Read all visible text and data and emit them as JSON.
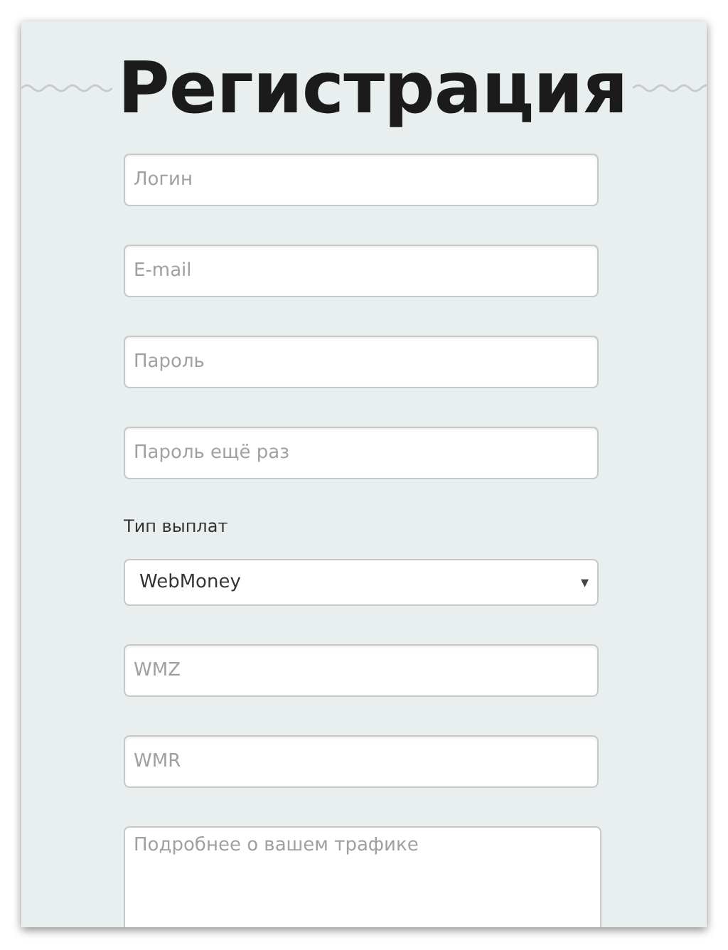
{
  "title": "Регистрация",
  "fields": [
    {
      "kind": "input",
      "placeholder": "Логин"
    },
    {
      "kind": "input",
      "placeholder": "E-mail"
    },
    {
      "kind": "input",
      "placeholder": "Пароль"
    },
    {
      "kind": "input",
      "placeholder": "Пароль ещё раз"
    },
    {
      "kind": "label",
      "text": "Тип выплат"
    },
    {
      "kind": "select",
      "value": "WebMoney",
      "arrow": "▾"
    },
    {
      "kind": "input",
      "placeholder": "WMZ"
    },
    {
      "kind": "input",
      "placeholder": "WMR"
    },
    {
      "kind": "textarea",
      "placeholder": "Подробнее о вашем трафике"
    }
  ]
}
